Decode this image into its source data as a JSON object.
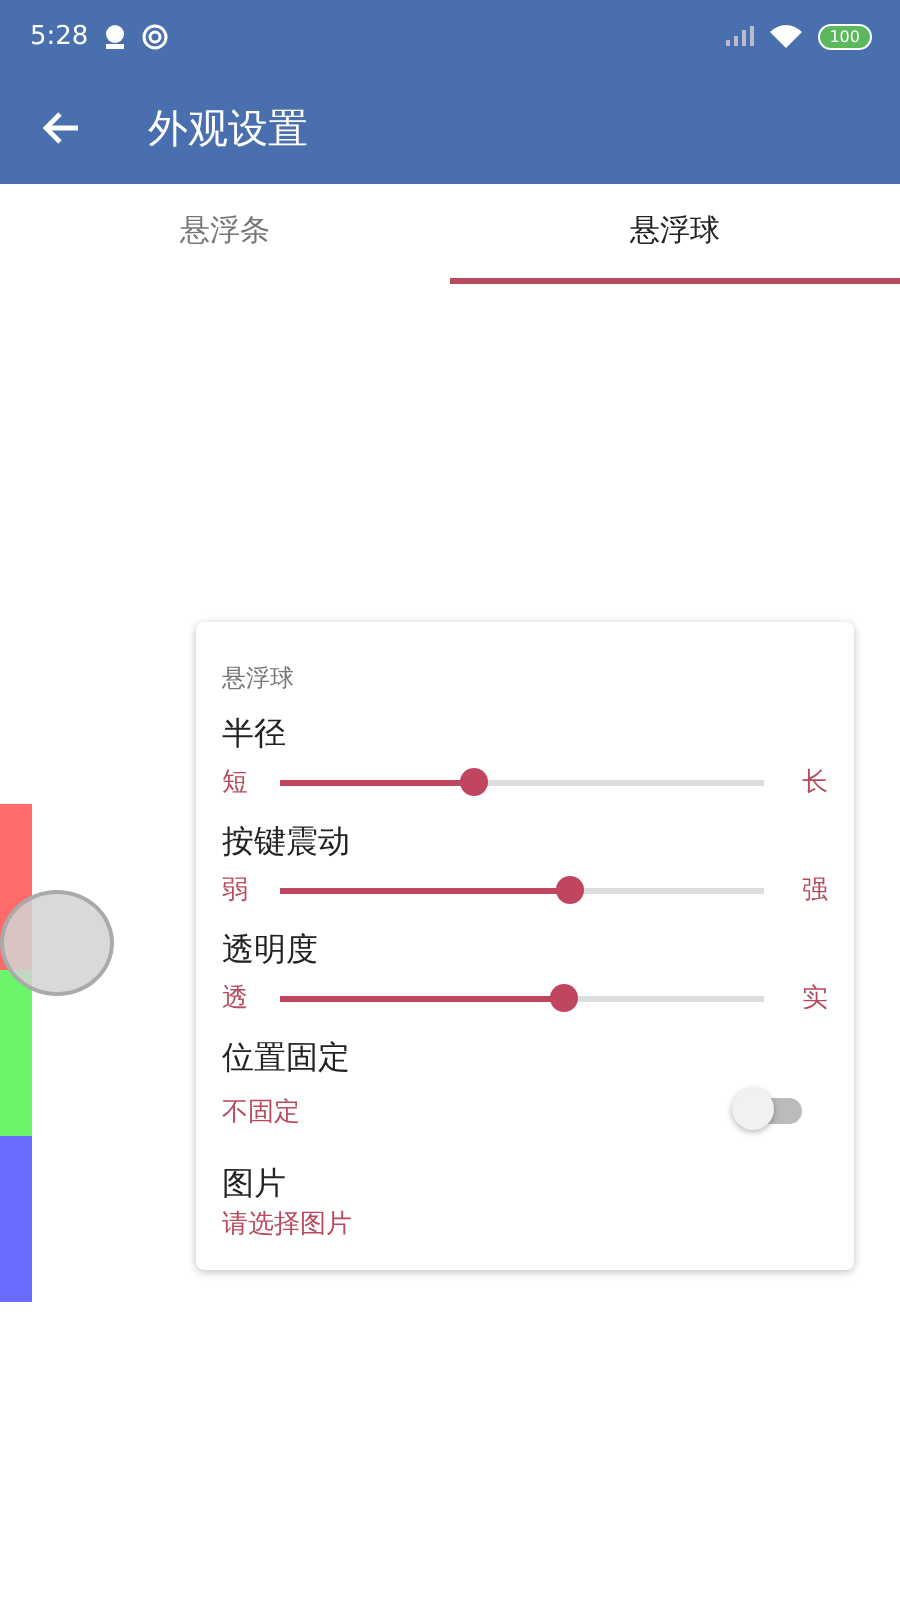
{
  "status_bar": {
    "time": "5:28",
    "battery": "100"
  },
  "app_bar": {
    "title": "外观设置"
  },
  "tabs": [
    {
      "label": "悬浮条",
      "selected": false
    },
    {
      "label": "悬浮球",
      "selected": true
    }
  ],
  "preview": {
    "segments": [
      {
        "color": "#ff6b6b"
      },
      {
        "color": "#6bf56b"
      },
      {
        "color": "#6b6bff"
      }
    ]
  },
  "card": {
    "title": "悬浮球",
    "sliders": [
      {
        "label": "半径",
        "min_label": "短",
        "max_label": "长",
        "level": 0.4
      },
      {
        "label": "按键震动",
        "min_label": "弱",
        "max_label": "强",
        "level": 0.6
      },
      {
        "label": "透明度",
        "min_label": "透",
        "max_label": "实",
        "level": 0.585
      }
    ],
    "switch": {
      "label": "位置固定",
      "value": "不固定",
      "on": false
    },
    "picture_setting": {
      "label": "图片",
      "value": "请选择图片"
    }
  }
}
